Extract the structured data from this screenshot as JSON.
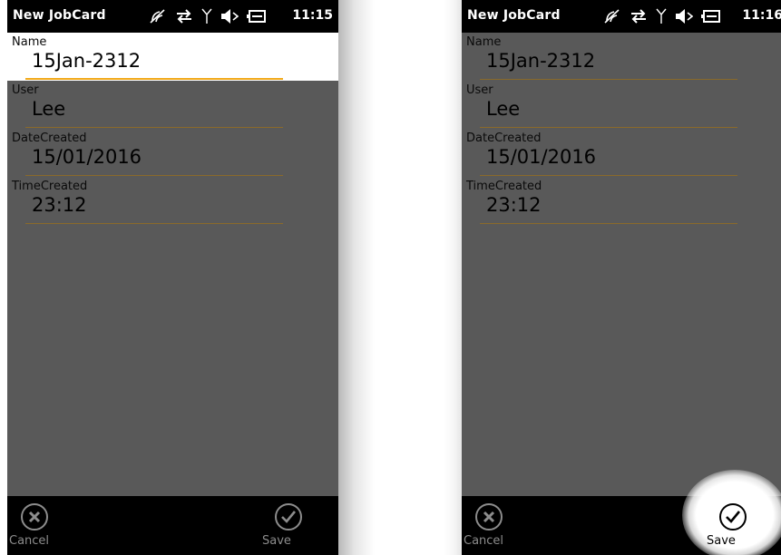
{
  "screens": [
    {
      "title": "New JobCard",
      "time": "11:15",
      "fields": [
        {
          "label": "Name",
          "value": "15Jan-2312"
        },
        {
          "label": "User",
          "value": "Lee"
        },
        {
          "label": "DateCreated",
          "value": "15/01/2016"
        },
        {
          "label": "TimeCreated",
          "value": "23:12"
        }
      ],
      "appbar": {
        "cancel_label": "Cancel",
        "save_label": "Save"
      }
    },
    {
      "title": "New JobCard",
      "time": "11:16",
      "fields": [
        {
          "label": "Name",
          "value": "15Jan-2312"
        },
        {
          "label": "User",
          "value": "Lee"
        },
        {
          "label": "DateCreated",
          "value": "15/01/2016"
        },
        {
          "label": "TimeCreated",
          "value": "23:12"
        }
      ],
      "appbar": {
        "cancel_label": "Cancel",
        "save_label": "Save"
      }
    }
  ],
  "status_icons": [
    "gps-off-icon",
    "data-transfer-icon",
    "signal-icon",
    "volume-muted-icon",
    "battery-charging-icon"
  ],
  "colors": {
    "background": "#595959",
    "statusbar": "#000000",
    "accent_underline": "#f2a91a",
    "active_field": "#ffffff",
    "appbar_icon": "#8c8c8c"
  }
}
